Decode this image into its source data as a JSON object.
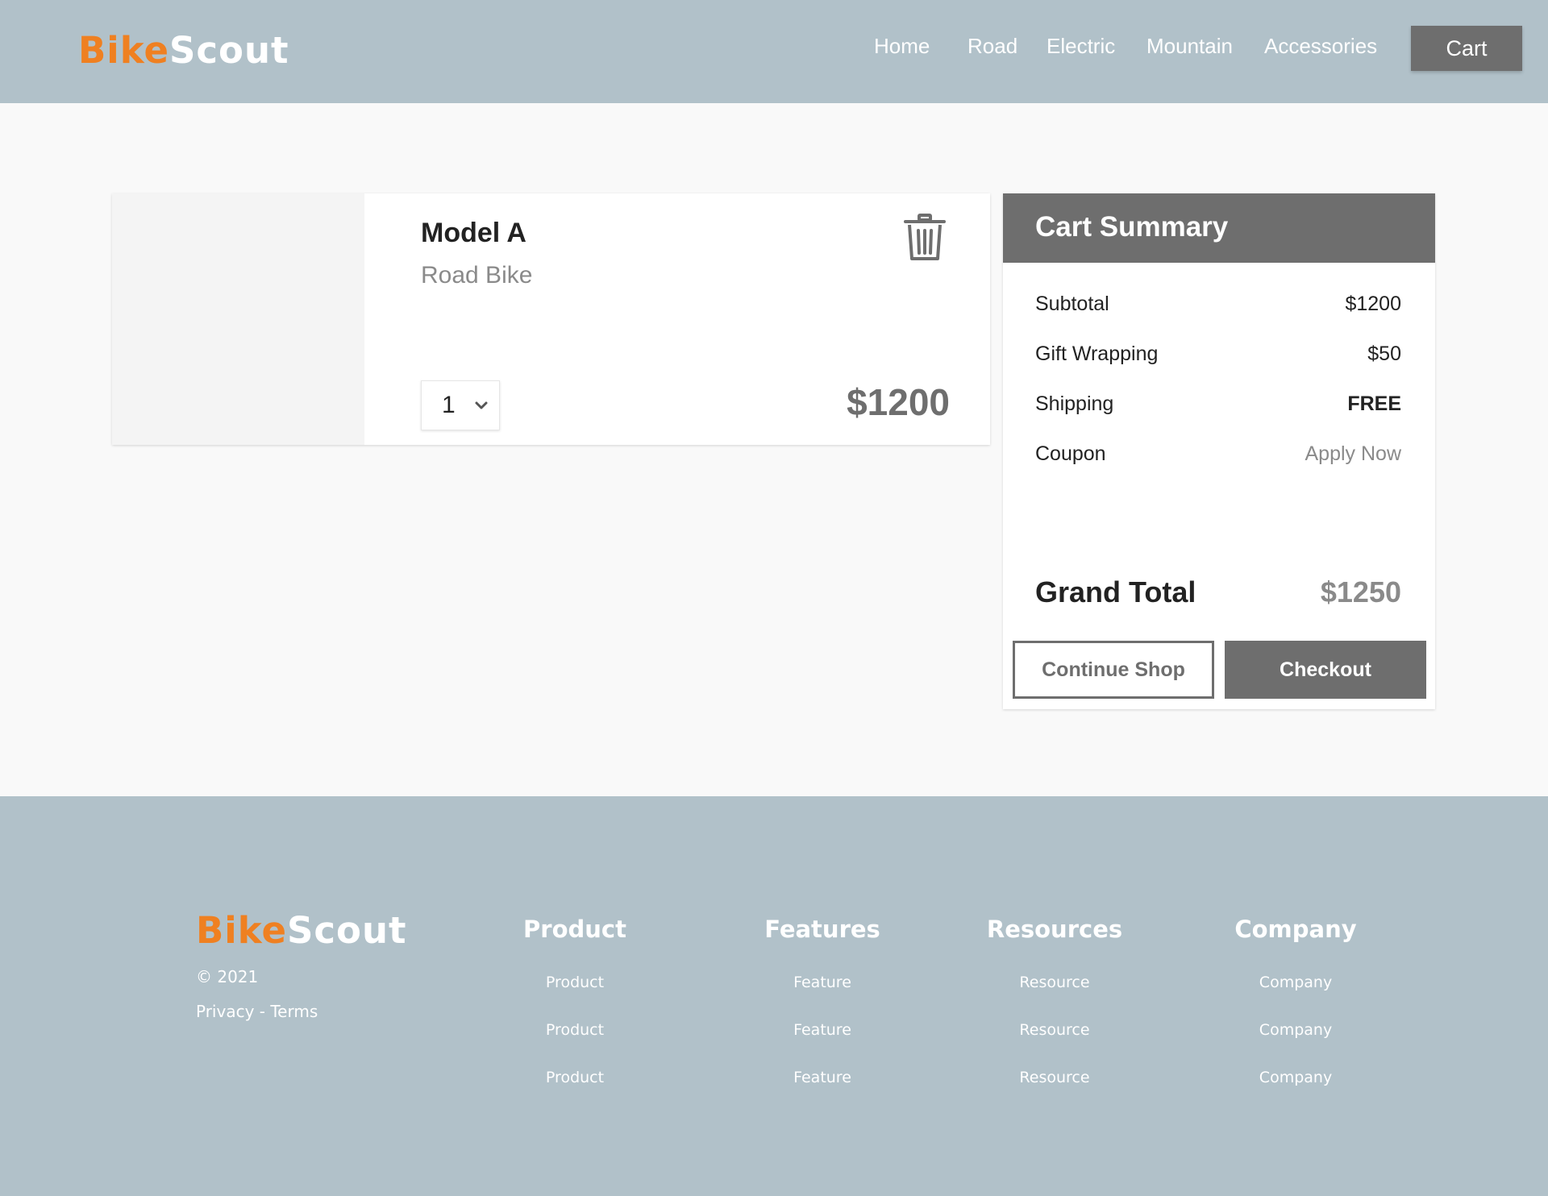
{
  "brand": {
    "part1": "Bike",
    "part2": "Scout",
    "color_primary": "#ef8021"
  },
  "nav": {
    "items": [
      {
        "label": "Home"
      },
      {
        "label": "Road"
      },
      {
        "label": "Electric"
      },
      {
        "label": "Mountain"
      },
      {
        "label": "Accessories"
      }
    ],
    "cart_label": "Cart"
  },
  "cart": {
    "item": {
      "name": "Model A",
      "type": "Road Bike",
      "quantity": "1",
      "price": "$1200",
      "delete_icon": "trash-icon"
    }
  },
  "summary": {
    "title": "Cart Summary",
    "rows": [
      {
        "label": "Subtotal",
        "value": "$1200"
      },
      {
        "label": "Gift Wrapping",
        "value": "$50"
      },
      {
        "label": "Shipping",
        "value": "FREE"
      },
      {
        "label": "Coupon",
        "value": "Apply Now"
      }
    ],
    "grand_total_label": "Grand Total",
    "grand_total_value": "$1250",
    "continue_label": "Continue Shop",
    "checkout_label": "Checkout"
  },
  "footer": {
    "copyright": "© 2021",
    "legal": "Privacy - Terms",
    "columns": [
      {
        "heading": "Product",
        "links": [
          "Product",
          "Product",
          "Product"
        ]
      },
      {
        "heading": "Features",
        "links": [
          "Feature",
          "Feature",
          "Feature"
        ]
      },
      {
        "heading": "Resources",
        "links": [
          "Resource",
          "Resource",
          "Resource"
        ]
      },
      {
        "heading": "Company",
        "links": [
          "Company",
          "Company",
          "Company"
        ]
      }
    ]
  },
  "colors": {
    "header_bg": "#b1c1c9",
    "dark_gray": "#6e6e6e",
    "muted_text": "#8a8a8a"
  }
}
